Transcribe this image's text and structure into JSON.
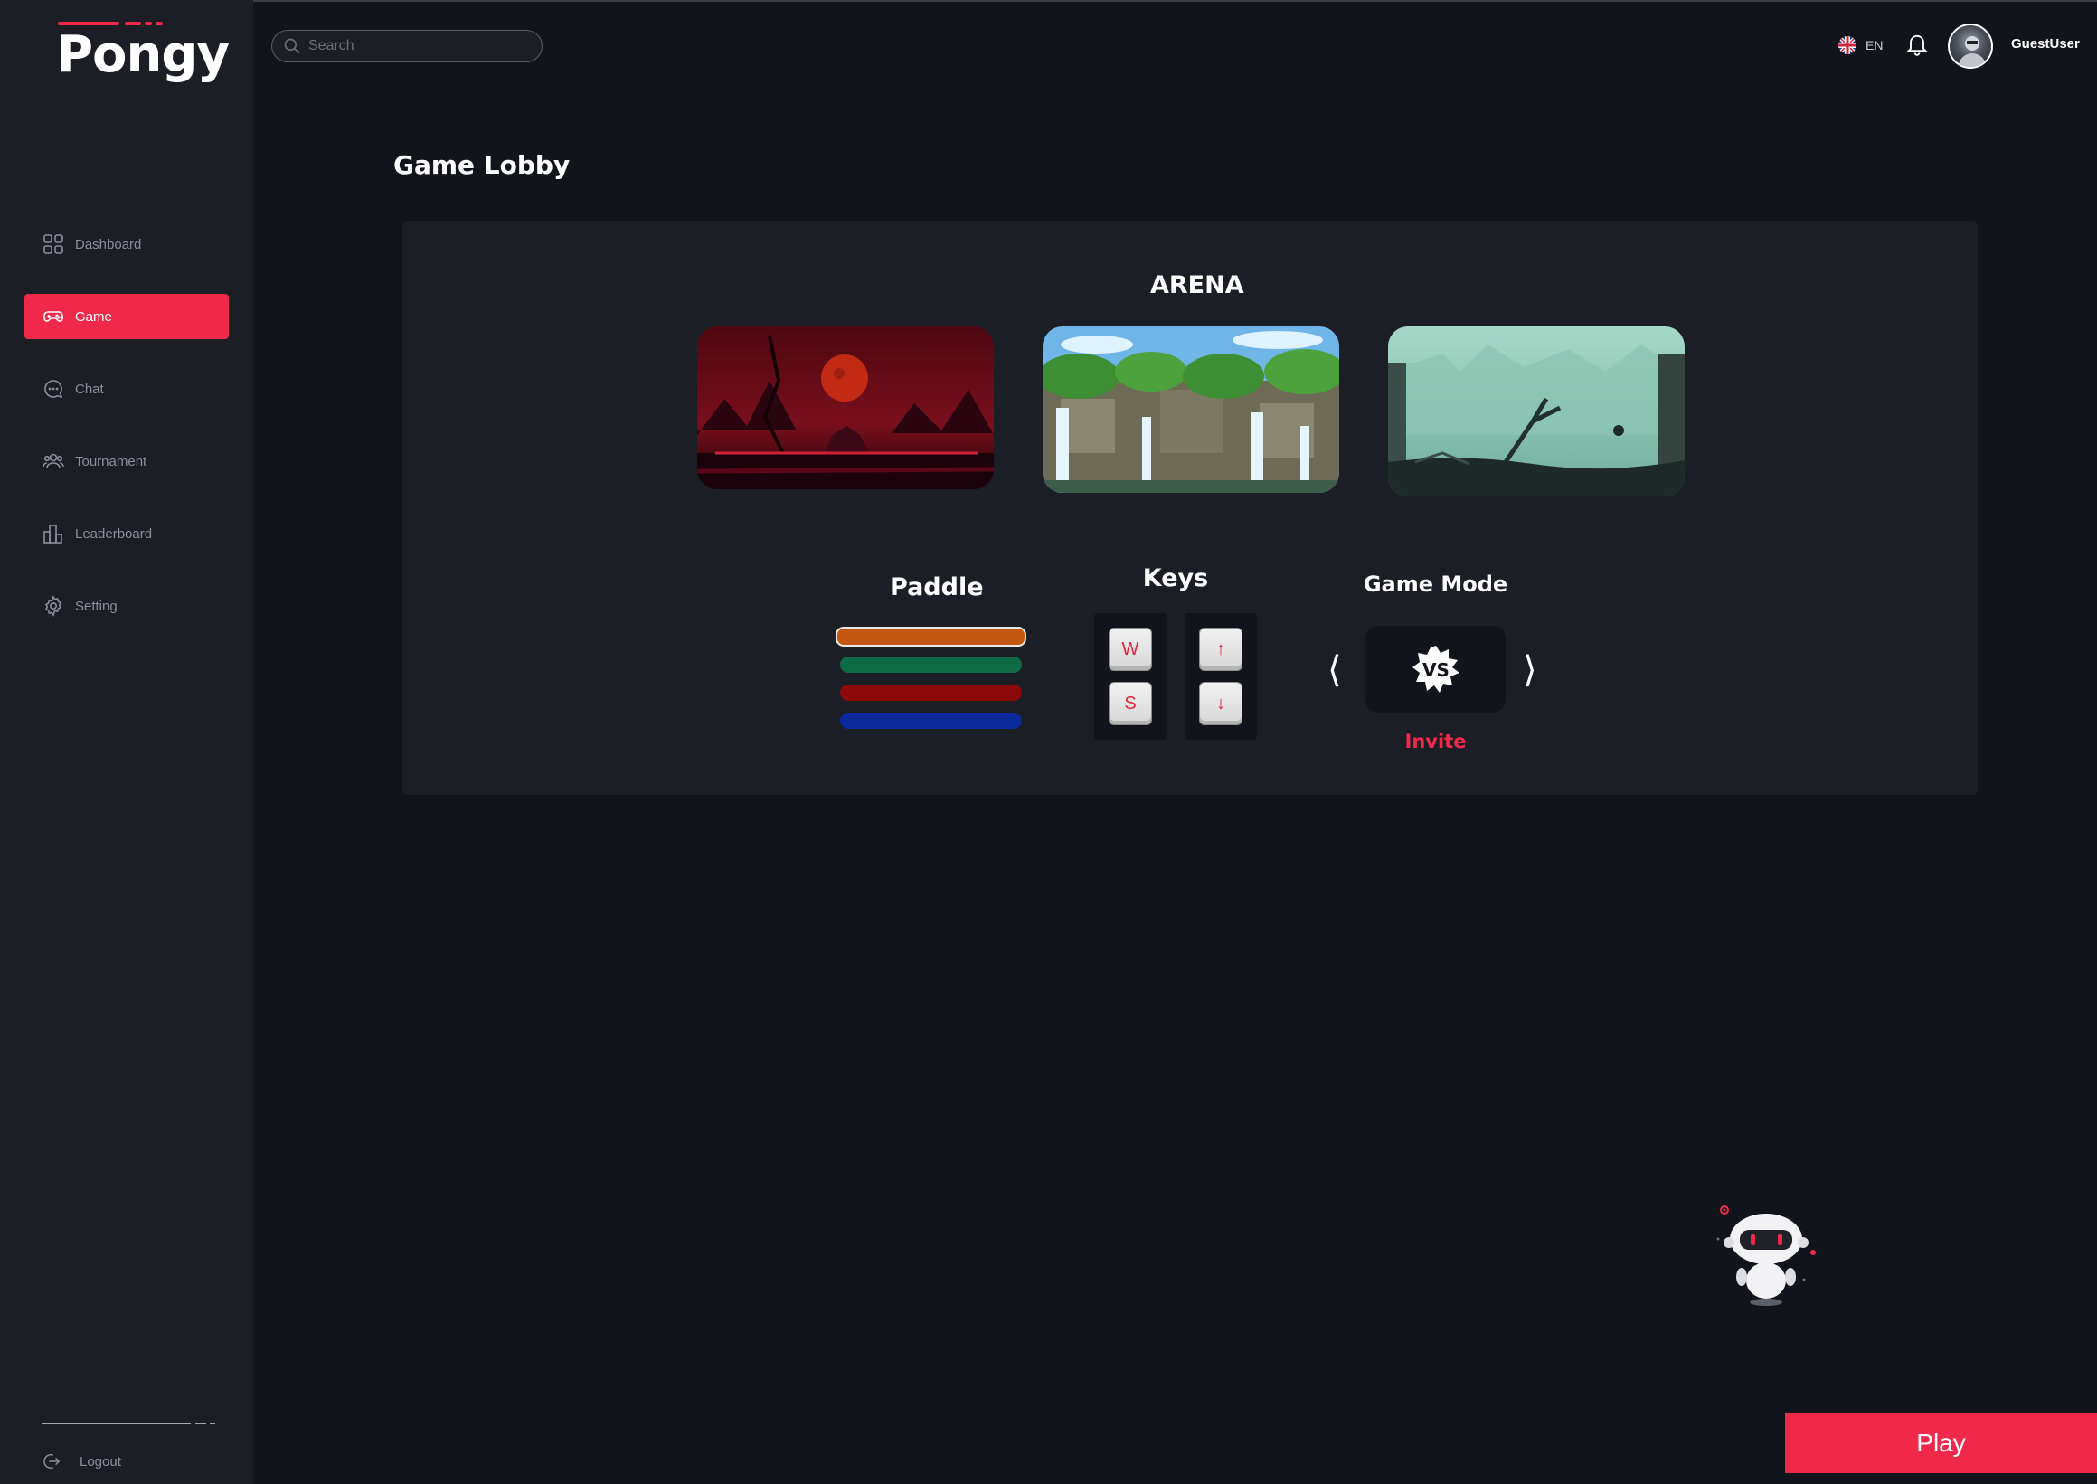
{
  "app": {
    "logo": "Pongy"
  },
  "sidebar": {
    "items": [
      {
        "label": "Dashboard",
        "icon": "grid-icon"
      },
      {
        "label": "Game",
        "icon": "gamepad-icon",
        "active": true
      },
      {
        "label": "Chat",
        "icon": "chat-bubble-icon"
      },
      {
        "label": "Tournament",
        "icon": "users-icon"
      },
      {
        "label": "Leaderboard",
        "icon": "bar-chart-icon"
      },
      {
        "label": "Setting",
        "icon": "gear-icon"
      }
    ],
    "logout_label": "Logout"
  },
  "header": {
    "search_placeholder": "Search",
    "language": "EN",
    "username": "GuestUser"
  },
  "main": {
    "title": "Game Lobby",
    "arena": {
      "title": "ARENA",
      "maps": [
        {
          "name": "blood-moon-arena"
        },
        {
          "name": "waterfall-jungle-arena"
        },
        {
          "name": "misty-ruins-arena"
        }
      ]
    },
    "paddle": {
      "title": "Paddle",
      "colors": [
        "#c4570f",
        "#0f6b45",
        "#8c0a0a",
        "#0d2a9c"
      ],
      "selected_index": 0
    },
    "keys": {
      "title": "Keys",
      "player1": [
        "W",
        "S"
      ],
      "player2": [
        "↑",
        "↓"
      ]
    },
    "game_mode": {
      "title": "Game Mode",
      "current": "VS",
      "action": "Invite"
    }
  },
  "play_label": "Play",
  "colors": {
    "accent": "#f0294a",
    "background": "#12141b",
    "panel": "#1c1e26"
  }
}
